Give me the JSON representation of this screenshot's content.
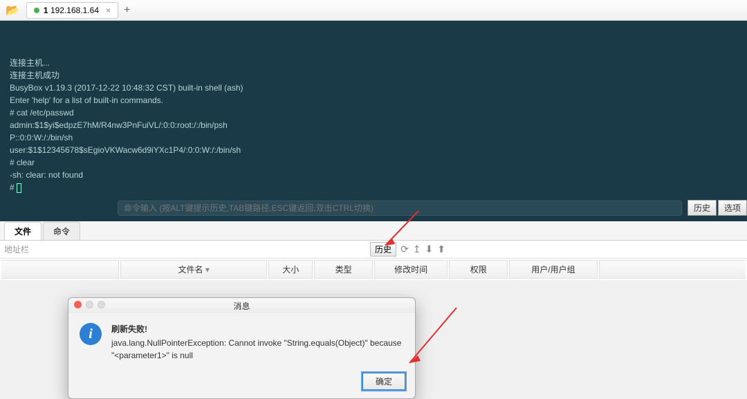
{
  "topbar": {
    "tab_number": "1",
    "tab_host": "192.168.1.64"
  },
  "terminal": {
    "lines": [
      "连接主机...",
      "连接主机成功",
      "",
      "BusyBox v1.19.3 (2017-12-22 10:48:32 CST) built-in shell (ash)",
      "Enter 'help' for a list of built-in commands.",
      "",
      "# cat /etc/passwd",
      "admin:$1$yi$edpzE7hM/R4nw3PnFuiVL/:0:0:root:/:/bin/psh",
      "P::0:0:W:/:/bin/sh",
      "user:$1$12345678$sEgioVKWacw6d9iYXc1P4/:0:0:W:/:/bin/sh",
      "# clear",
      "-sh: clear: not found",
      "# "
    ],
    "cmd_placeholder": "命令输入 (按ALT键提示历史,TAB键路径,ESC键返回,双击CTRL切换)",
    "history_btn": "历史",
    "options_btn": "选项"
  },
  "subtabs": {
    "file": "文件",
    "command": "命令"
  },
  "addressbar": {
    "placeholder": "地址栏",
    "history": "历史"
  },
  "columns": {
    "name": "文件名",
    "size": "大小",
    "type": "类型",
    "mtime": "修改时间",
    "perm": "权限",
    "user": "用户/用户组"
  },
  "dialog": {
    "title": "消息",
    "heading": "刷新失败!",
    "body": "java.lang.NullPointerException: Cannot invoke \"String.equals(Object)\" because \"<parameter1>\" is null",
    "ok": "确定"
  }
}
